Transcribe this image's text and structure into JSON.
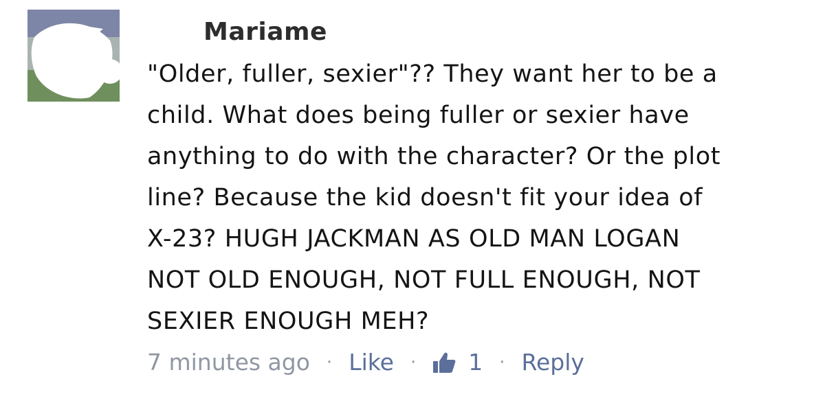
{
  "comment": {
    "author": "Mariame",
    "lines": [
      "\"Older, fuller, sexier\"?? They want her to be a",
      "child. What does being fuller or sexier have",
      "anything to do with the character? Or the plot",
      "line? Because the kid doesn't fit your idea of",
      "X-23? HUGH JACKMAN AS OLD MAN LOGAN",
      "NOT OLD ENOUGH, NOT FULL ENOUGH, NOT",
      "SEXIER ENOUGH MEH?"
    ],
    "timestamp": "7 minutes ago",
    "like_label": "Like",
    "like_count": "1",
    "reply_label": "Reply",
    "separator": "·"
  },
  "icons": {
    "thumbs_up": "thumbs-up-icon"
  },
  "colors": {
    "link": "#5b6f9a",
    "meta": "#9097a3",
    "text": "#141414"
  }
}
